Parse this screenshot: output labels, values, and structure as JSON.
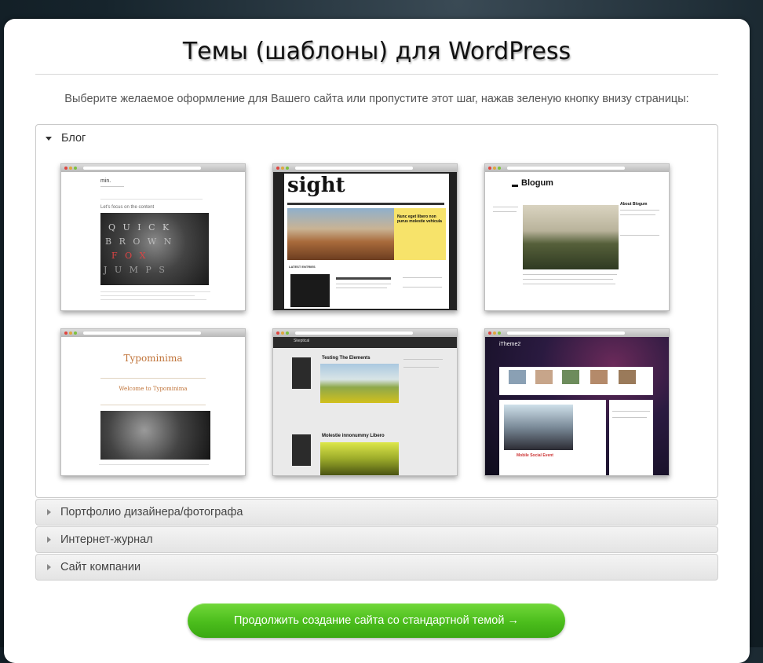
{
  "page": {
    "title": "Темы (шаблоны) для WordPress",
    "subtitle": "Выберите желаемое оформление для Вашего сайта или пропустите этот шаг, нажав зеленую кнопку внизу страницы:"
  },
  "sections": [
    {
      "label": "Блог",
      "expanded": true
    },
    {
      "label": "Портфолио дизайнера/фотографа",
      "expanded": false
    },
    {
      "label": "Интернет-журнал",
      "expanded": false
    },
    {
      "label": "Сайт компании",
      "expanded": false
    }
  ],
  "themes": [
    {
      "name": "min.",
      "tagline": "Let's focus on the content"
    },
    {
      "name": "sight",
      "headline": "Nunc eget libero non purus molestie vehicula",
      "section": "LATEST ENTRIES"
    },
    {
      "name": "Blogum",
      "sidebar_title": "About Blogum"
    },
    {
      "name": "Typominima",
      "welcome": "Welcome to Typominima"
    },
    {
      "name": "Skeptical",
      "post1": "Testing The Elements",
      "post2": "Molestie innonummy Libero"
    },
    {
      "name": "iTheme2",
      "post": "Mobile Social Event"
    }
  ],
  "continue_button": {
    "label": "Продолжить создание сайта со стандартной темой →"
  },
  "colors": {
    "accent_green": "#4bbd1c",
    "sight_yellow": "#f7e36a"
  }
}
